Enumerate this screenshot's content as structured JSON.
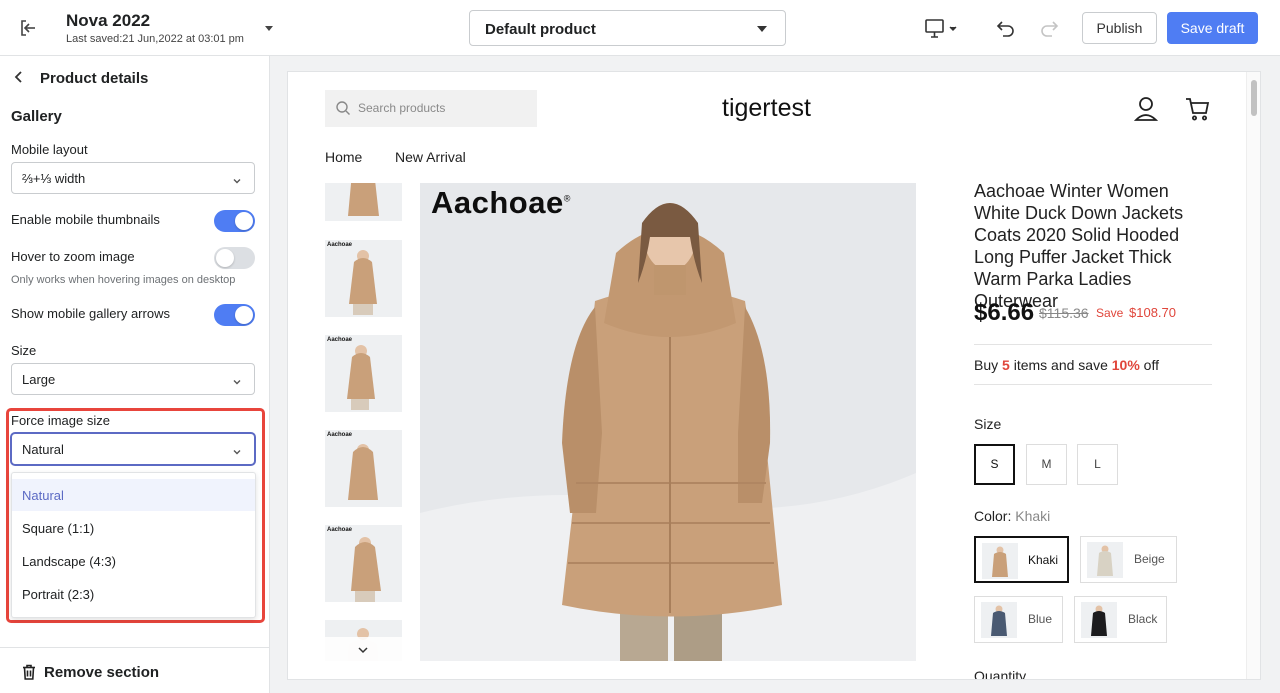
{
  "topbar": {
    "theme_name": "Nova 2022",
    "last_saved": "Last saved:21 Jun,2022 at 03:01 pm",
    "template_select": "Default product",
    "publish_label": "Publish",
    "save_draft_label": "Save draft",
    "icons": [
      "exit-icon",
      "desktop-icon",
      "undo-icon",
      "redo-icon"
    ]
  },
  "sidebar": {
    "panel_title": "Product details",
    "section_heading": "Gallery",
    "mobile_layout_label": "Mobile layout",
    "mobile_layout_value": "⅔+⅓ width",
    "enable_thumbs_label": "Enable mobile thumbnails",
    "enable_thumbs_on": true,
    "hover_zoom_label": "Hover to zoom image",
    "hover_zoom_on": false,
    "hover_zoom_help": "Only works when hovering images on desktop",
    "show_arrows_label": "Show mobile gallery  arrows",
    "show_arrows_on": true,
    "size_label": "Size",
    "size_value": "Large",
    "force_size_label": "Force image size",
    "force_size_value": "Natural",
    "force_size_options": [
      "Natural",
      "Square (1:1)",
      "Landscape (4:3)",
      "Portrait (2:3)"
    ],
    "remove_section_label": "Remove section"
  },
  "preview": {
    "search_placeholder": "Search products",
    "store_name": "tigertest",
    "nav": [
      "Home",
      "New Arrival"
    ],
    "brand": "Aachoae",
    "brand_mark": "®",
    "thumb_brand": "Aachoae",
    "product_title": "Aachoae Winter Women White Duck Down Jackets Coats 2020 Solid Hooded Long Puffer Jacket Thick Warm Parka Ladies Outerwear",
    "price": "$6.66",
    "compare_price": "$115.36",
    "save_label": "Save",
    "save_amount": "$108.70",
    "bulk": {
      "prefix": "Buy ",
      "qty": "5",
      "mid": " items and save ",
      "pct": "10%",
      "suffix": " off"
    },
    "size_label": "Size",
    "sizes": [
      "S",
      "M",
      "L"
    ],
    "selected_size": "S",
    "color_label": "Color: ",
    "color_selected": "Khaki",
    "colors": [
      "Khaki",
      "Beige",
      "Blue",
      "Black"
    ],
    "quantity_label": "Quantity"
  },
  "colors": {
    "accent": "#4f7df3",
    "highlight": "#e8453c",
    "sale": "#e0463b",
    "coat_khaki": "#c9a07a",
    "coat_beige": "#d8d2c4",
    "coat_blue": "#4a5a72",
    "coat_black": "#1c1c1e"
  }
}
